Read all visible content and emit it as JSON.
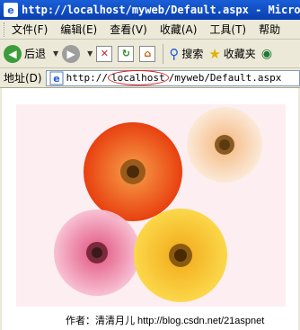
{
  "window": {
    "title": "http://localhost/myweb/Default.aspx - Microsoft"
  },
  "menu": {
    "items": [
      "文件(F)",
      "编辑(E)",
      "查看(V)",
      "收藏(A)",
      "工具(T)",
      "帮助"
    ]
  },
  "toolbar": {
    "back_label": "后退",
    "search_label": "搜索",
    "favorites_label": "收藏夹"
  },
  "address": {
    "label": "地址(D)",
    "url_prefix": "http://",
    "url_host": "localhost",
    "url_path": "/myweb/Default.aspx"
  },
  "content": {
    "caption": "作者：清清月儿 http://blog.csdn.net/21aspnet",
    "colors": {
      "background": "#fdeef1",
      "flower_orange": "#f05a1a",
      "flower_peach": "#f7d9b8",
      "flower_pink": "#ef7aa4",
      "flower_yellow": "#f7c21d"
    }
  }
}
